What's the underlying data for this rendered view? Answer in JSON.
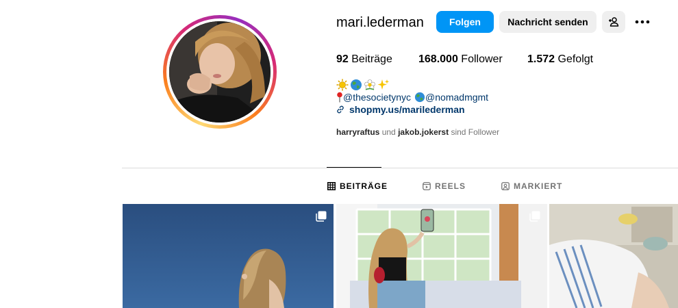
{
  "profile": {
    "username": "mari.lederman",
    "follow_label": "Folgen",
    "message_label": "Nachricht senden",
    "stats": {
      "posts_count": "92",
      "posts_label": "Beiträge",
      "followers_count": "168.000",
      "followers_label": "Follower",
      "following_count": "1.572",
      "following_label": "Gefolgt"
    },
    "bio": {
      "emojis": [
        "sun-emoji",
        "globe-emoji",
        "flower-emoji",
        "sparkles-emoji"
      ],
      "mention_1": "@thesocietynyc",
      "mention_2": "@nomadmgmt",
      "link": "shopmy.us/marilederman"
    },
    "followed_by": {
      "user_1": "harryraftus",
      "connector": "und",
      "user_2": "jakob.jokerst",
      "suffix": "sind Follower"
    }
  },
  "tabs": [
    {
      "label": "BEITRÄGE",
      "icon": "grid-icon",
      "active": true
    },
    {
      "label": "REELS",
      "icon": "reels-icon",
      "active": false
    },
    {
      "label": "MARKIERT",
      "icon": "tagged-icon",
      "active": false
    }
  ],
  "posts": [
    {
      "icon": "multiple-images-icon"
    },
    {
      "icon": "multiple-images-icon"
    },
    {
      "icon": ""
    }
  ],
  "colors": {
    "accent": "#0095f6",
    "link": "#00376b",
    "secondary_button": "#efefef",
    "muted_text": "#737373",
    "divider": "#dbdbdb"
  }
}
